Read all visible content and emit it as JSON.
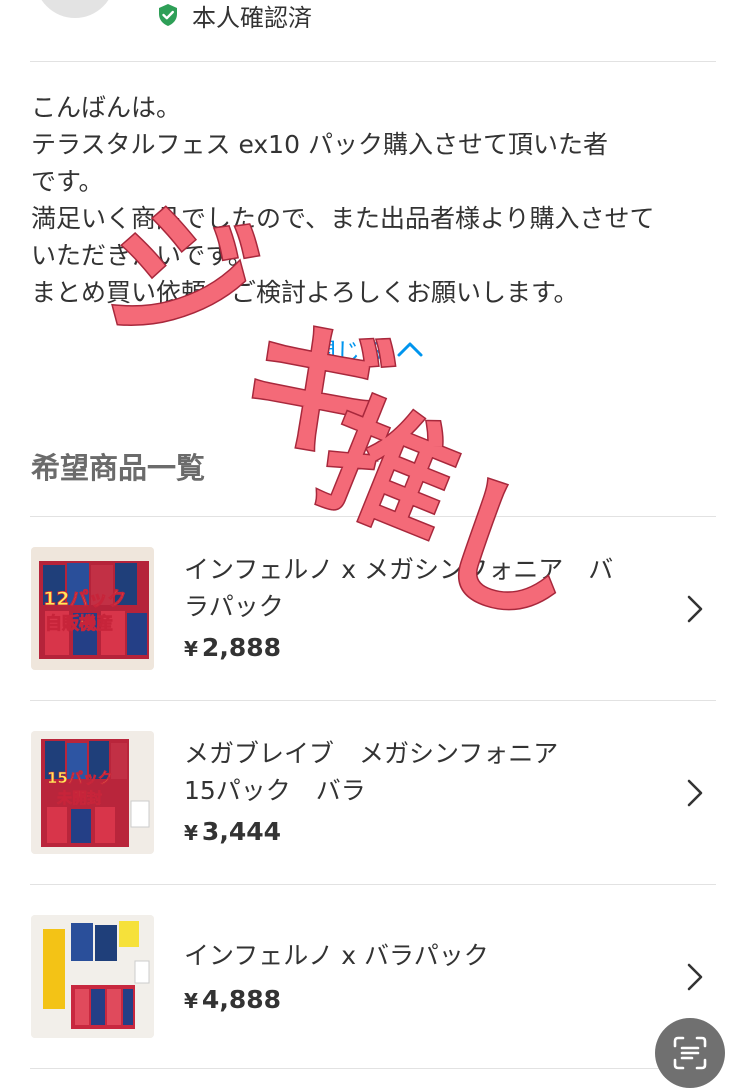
{
  "profile": {
    "verified_label": "本人確認済"
  },
  "message": {
    "lines": [
      "こんばんは。",
      "テラスタルフェス ex10 パック購入させて頂いた者",
      "です。",
      "満足いく商品でしたので、また出品者様より購入させて",
      "いただきたいです。",
      "まとめ買い依頼、ご検討よろしくお願いします。"
    ],
    "collapse_label": "閉じる"
  },
  "wishlist": {
    "title": "希望商品一覧",
    "items": [
      {
        "title_lines": [
          "インフェルノ x メガシンフォニア　バ",
          "ラパック"
        ],
        "currency": "¥",
        "price": "2,888",
        "thumb_caption": [
          "12パック",
          "自販機産"
        ]
      },
      {
        "title_lines": [
          "メガブレイブ　メガシンフォニア",
          "15パック　バラ"
        ],
        "currency": "¥",
        "price": "3,444",
        "thumb_caption": [
          "15パック",
          "未開封"
        ]
      },
      {
        "title_lines": [
          "インフェルノ x バラパック"
        ],
        "currency": "¥",
        "price": "4,888",
        "thumb_caption": []
      }
    ]
  },
  "overlay": {
    "handwriting": [
      "ジ",
      "ギ",
      "推",
      "し"
    ],
    "color": "#f46a78"
  },
  "colors": {
    "accent_blue": "#0095ee",
    "verified_green": "#2e9f57",
    "divider": "#e2e2e2"
  },
  "icons": {
    "verified": "shield-check-icon",
    "collapse": "chevron-up-icon",
    "row_arrow": "chevron-right-icon",
    "scan": "text-scan-icon"
  }
}
